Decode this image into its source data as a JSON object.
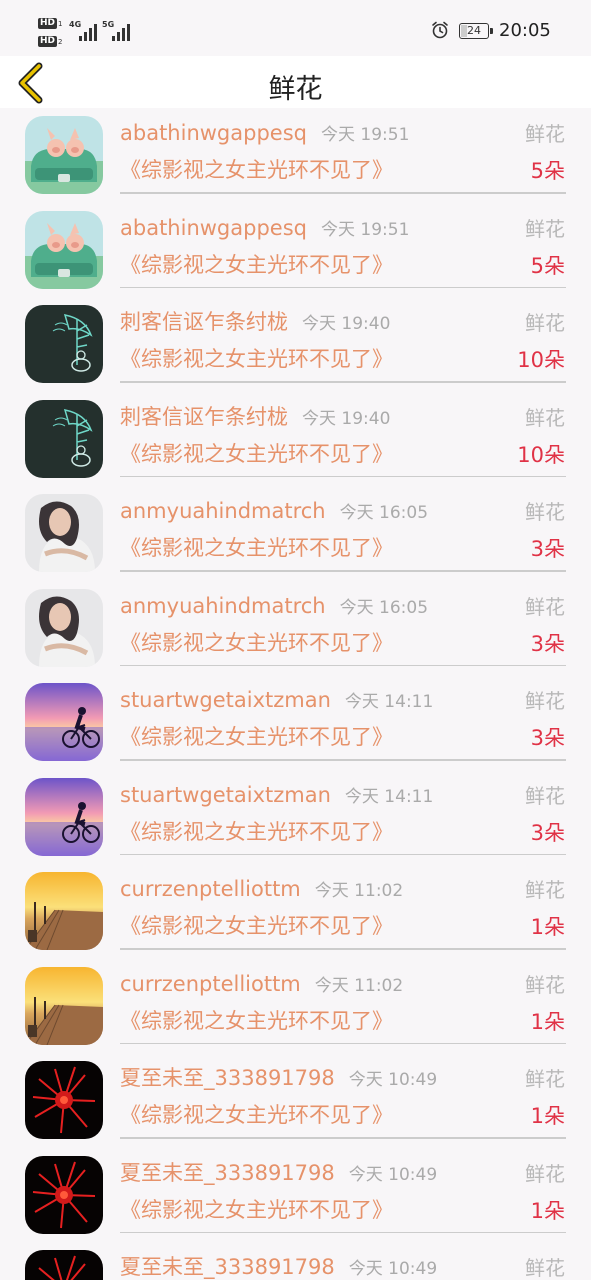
{
  "status_bar": {
    "hd1": "HD",
    "hd1_sub": "1",
    "hd2": "HD",
    "hd2_sub": "2",
    "net1": "4G",
    "net2": "5G",
    "battery": "24",
    "battery_level": 0.24,
    "time": "20:05",
    "alarm_icon": "alarm-clock-icon"
  },
  "nav": {
    "back_icon": "chevron-left-icon",
    "title": "鲜花",
    "accent": "#e8c200"
  },
  "colors": {
    "username": "#e6926a",
    "book": "#e6926a",
    "count": "#e03246",
    "label": "#b8b8b8",
    "time": "#aaaaaa"
  },
  "records": [
    {
      "user": "abathinwgappesq",
      "time": "今天 19:51",
      "label": "鲜花",
      "book": "《综影视之女主光环不见了》",
      "count": "5朵",
      "avatar": "pig-car"
    },
    {
      "user": "abathinwgappesq",
      "time": "今天 19:51",
      "label": "鲜花",
      "book": "《综影视之女主光环不见了》",
      "count": "5朵",
      "avatar": "pig-car"
    },
    {
      "user": "刺客信讴乍条纣栊",
      "time": "今天 19:40",
      "label": "鲜花",
      "book": "《综影视之女主光环不见了》",
      "count": "10朵",
      "avatar": "chalkboard"
    },
    {
      "user": "刺客信讴乍条纣栊",
      "time": "今天 19:40",
      "label": "鲜花",
      "book": "《综影视之女主光环不见了》",
      "count": "10朵",
      "avatar": "chalkboard"
    },
    {
      "user": "anmyuahindmatrch",
      "time": "今天 16:05",
      "label": "鲜花",
      "book": "《综影视之女主光环不见了》",
      "count": "3朵",
      "avatar": "portrait"
    },
    {
      "user": "anmyuahindmatrch",
      "time": "今天 16:05",
      "label": "鲜花",
      "book": "《综影视之女主光环不见了》",
      "count": "3朵",
      "avatar": "portrait"
    },
    {
      "user": "stuartwgetaixtzman",
      "time": "今天 14:11",
      "label": "鲜花",
      "book": "《综影视之女主光环不见了》",
      "count": "3朵",
      "avatar": "cyclist-sunset"
    },
    {
      "user": "stuartwgetaixtzman",
      "time": "今天 14:11",
      "label": "鲜花",
      "book": "《综影视之女主光环不见了》",
      "count": "3朵",
      "avatar": "cyclist-sunset"
    },
    {
      "user": "currzenptelliottm",
      "time": "今天 11:02",
      "label": "鲜花",
      "book": "《综影视之女主光环不见了》",
      "count": "1朵",
      "avatar": "pier-sunset"
    },
    {
      "user": "currzenptelliottm",
      "time": "今天 11:02",
      "label": "鲜花",
      "book": "《综影视之女主光环不见了》",
      "count": "1朵",
      "avatar": "pier-sunset"
    },
    {
      "user": "夏至未至_333891798",
      "time": "今天 10:49",
      "label": "鲜花",
      "book": "《综影视之女主光环不见了》",
      "count": "1朵",
      "avatar": "red-flower"
    },
    {
      "user": "夏至未至_333891798",
      "time": "今天 10:49",
      "label": "鲜花",
      "book": "《综影视之女主光环不见了》",
      "count": "1朵",
      "avatar": "red-flower"
    },
    {
      "user": "夏至未至_333891798",
      "time": "今天 10:49",
      "label": "鲜花",
      "book": "",
      "count": "",
      "avatar": "red-flower"
    }
  ]
}
